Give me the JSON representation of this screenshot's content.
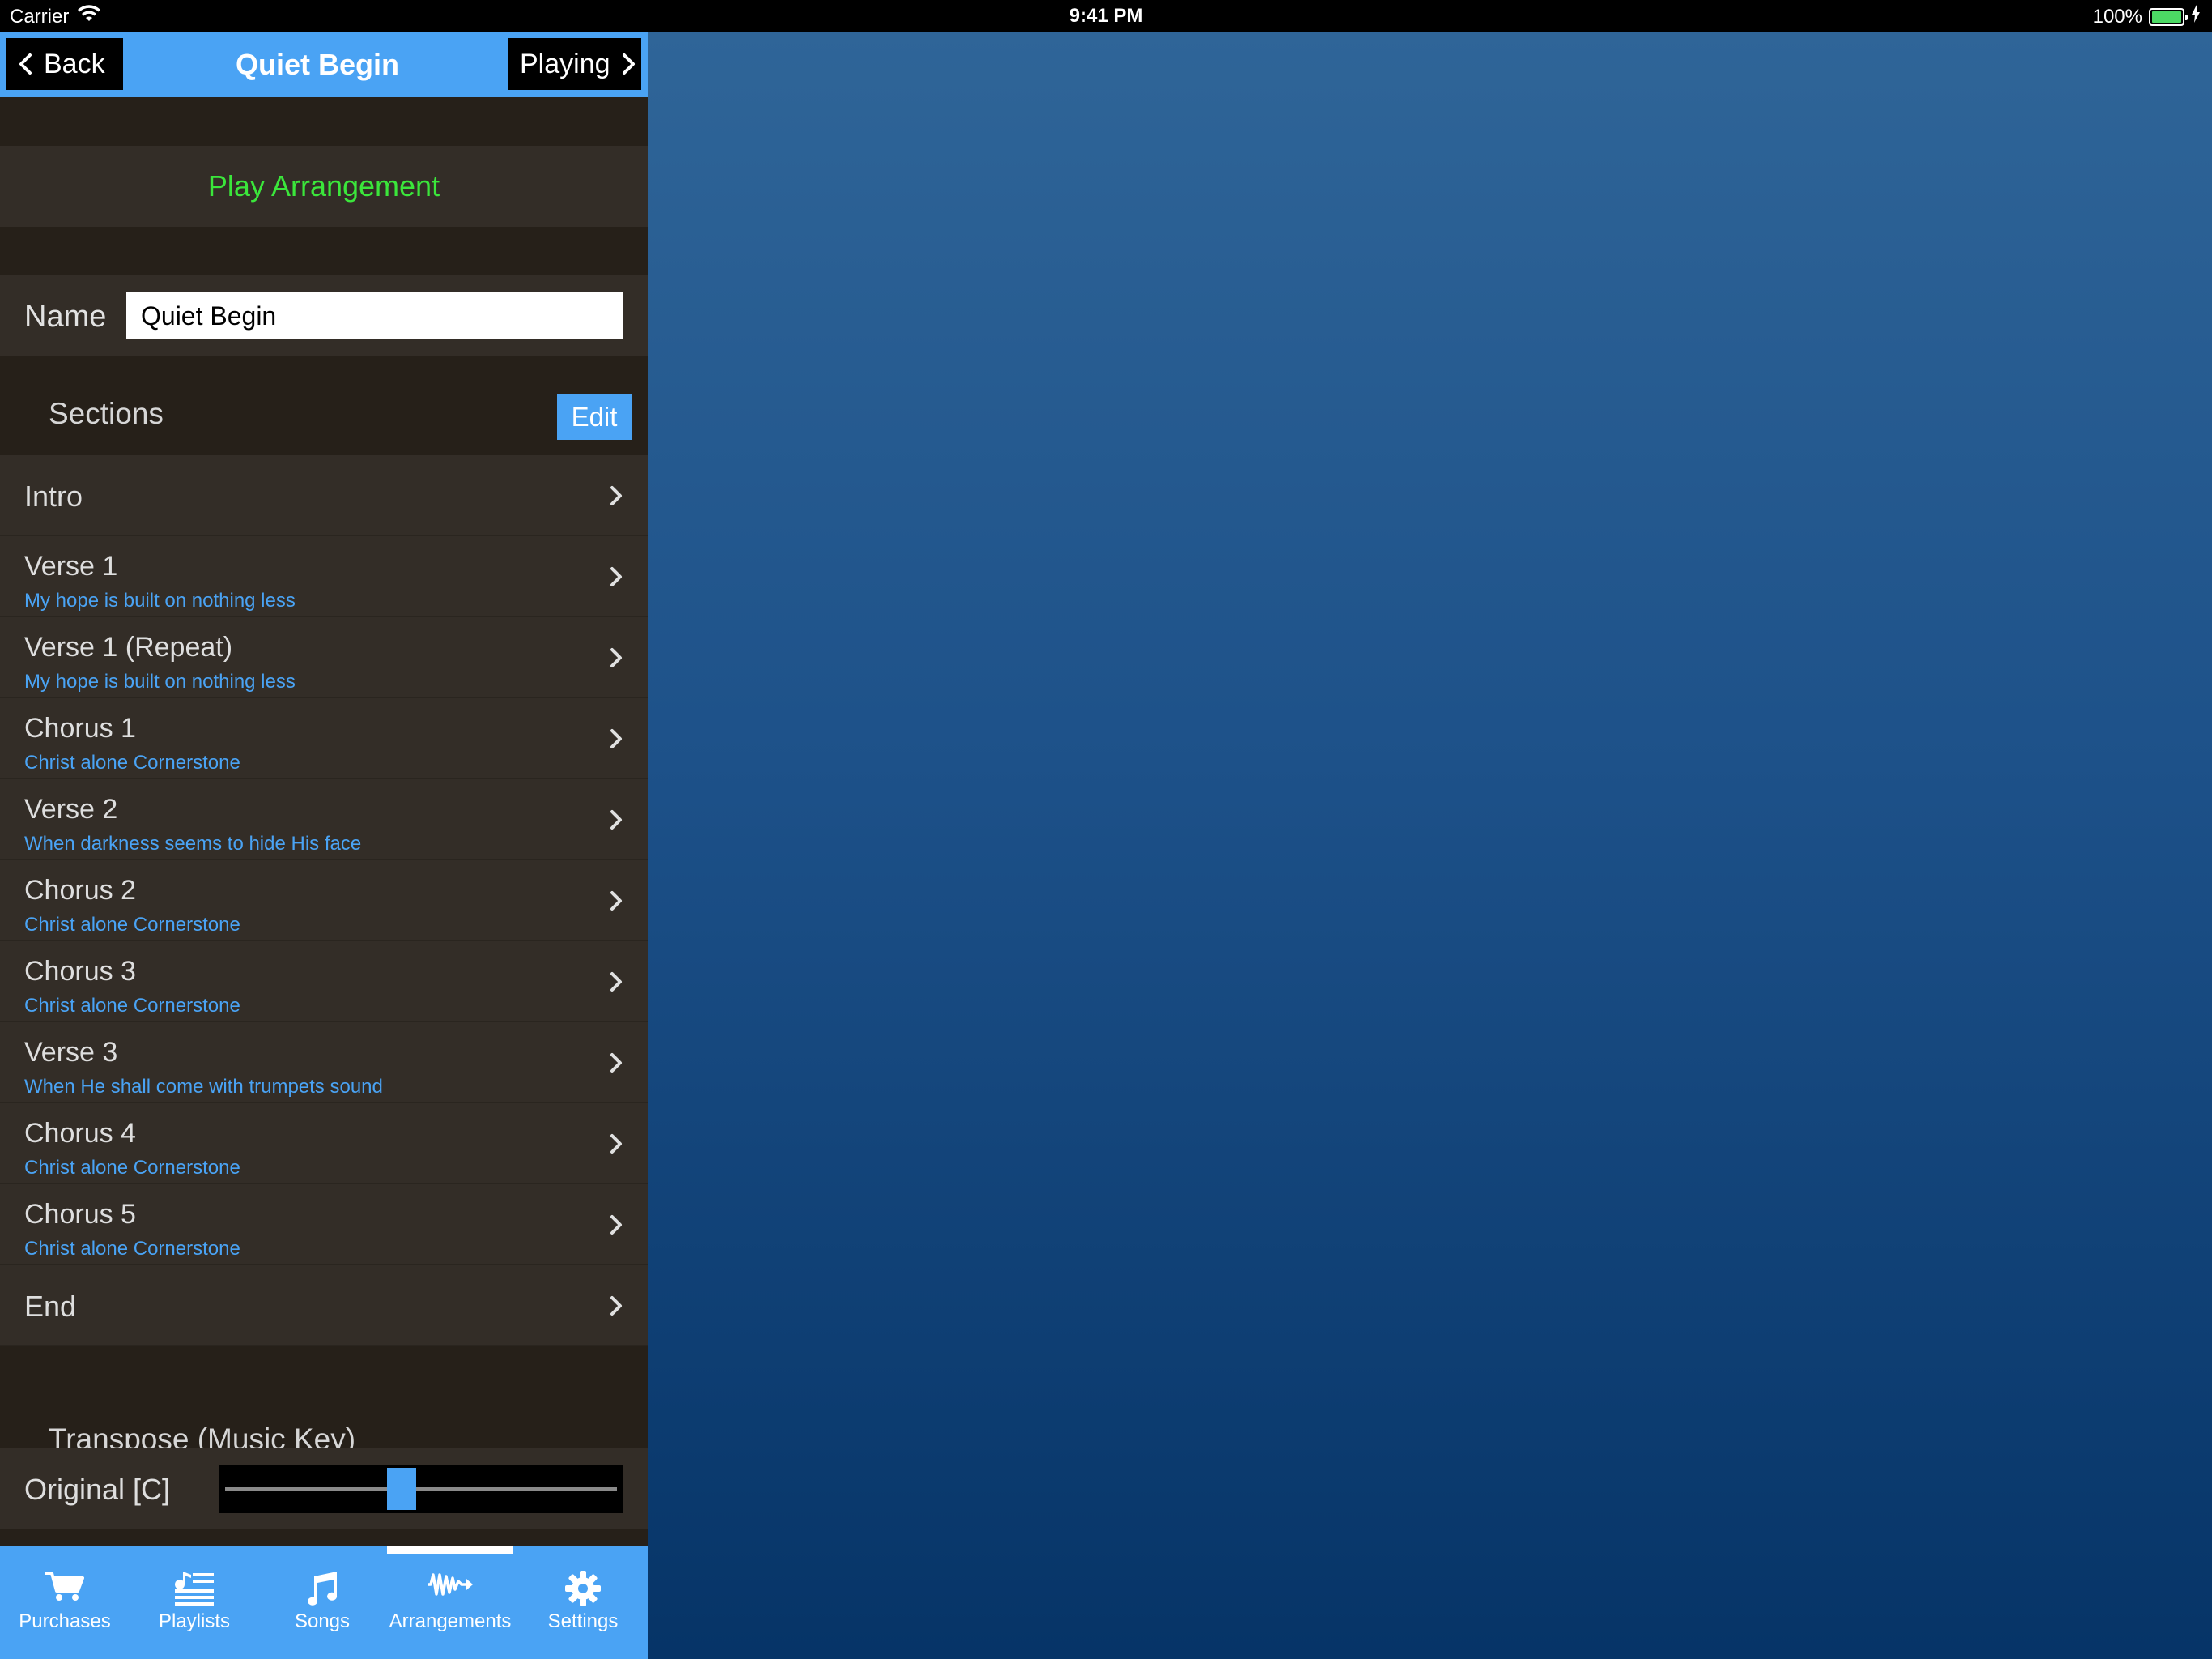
{
  "status_bar": {
    "carrier": "Carrier",
    "time": "9:41 PM",
    "battery": "100%"
  },
  "nav": {
    "back_label": "Back",
    "title": "Quiet Begin",
    "playing_label": "Playing"
  },
  "play_arrangement_label": "Play Arrangement",
  "name_field": {
    "label": "Name",
    "value": "Quiet Begin"
  },
  "sections": {
    "title": "Sections",
    "edit_label": "Edit",
    "items": [
      {
        "title": "Intro",
        "subtitle": ""
      },
      {
        "title": "Verse 1",
        "subtitle": "My hope is built on nothing less"
      },
      {
        "title": "Verse 1 (Repeat)",
        "subtitle": "My hope is built on nothing less"
      },
      {
        "title": "Chorus 1",
        "subtitle": "Christ alone Cornerstone"
      },
      {
        "title": "Verse 2",
        "subtitle": "When darkness seems to hide His face"
      },
      {
        "title": "Chorus 2",
        "subtitle": "Christ alone Cornerstone"
      },
      {
        "title": "Chorus 3",
        "subtitle": "Christ alone Cornerstone"
      },
      {
        "title": "Verse 3",
        "subtitle": "When He shall come with trumpets sound"
      },
      {
        "title": "Chorus 4",
        "subtitle": "Christ alone Cornerstone"
      },
      {
        "title": "Chorus 5",
        "subtitle": "Christ alone Cornerstone"
      },
      {
        "title": "End",
        "subtitle": ""
      }
    ]
  },
  "transpose": {
    "title": "Transpose (Music Key)",
    "value_label": "Original [C]",
    "slider_fraction": 0.5
  },
  "tabs": [
    {
      "label": "Purchases",
      "icon": "cart-icon"
    },
    {
      "label": "Playlists",
      "icon": "playlist-icon"
    },
    {
      "label": "Songs",
      "icon": "music-note-icon"
    },
    {
      "label": "Arrangements",
      "icon": "arrangement-icon"
    },
    {
      "label": "Settings",
      "icon": "gear-icon"
    }
  ],
  "selected_tab": "Arrangements",
  "colors": {
    "accent": "#4aa3f4",
    "play": "#3be63b",
    "subtitle": "#4aa3f4",
    "cell": "#332d27",
    "background": "#262019"
  }
}
